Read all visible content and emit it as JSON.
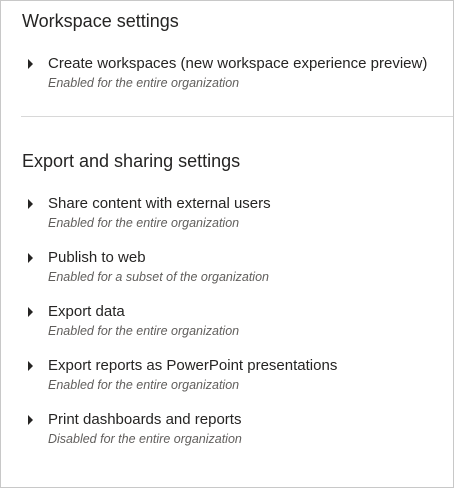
{
  "sections": [
    {
      "title": "Workspace settings",
      "items": [
        {
          "title": "Create workspaces (new workspace experience preview)",
          "status": "Enabled for the entire organization"
        }
      ]
    },
    {
      "title": "Export and sharing settings",
      "items": [
        {
          "title": "Share content with external users",
          "status": "Enabled for the entire organization"
        },
        {
          "title": "Publish to web",
          "status": "Enabled for a subset of the organization"
        },
        {
          "title": "Export data",
          "status": "Enabled for the entire organization"
        },
        {
          "title": "Export reports as PowerPoint presentations",
          "status": "Enabled for the entire organization"
        },
        {
          "title": "Print dashboards and reports",
          "status": "Disabled for the entire organization"
        }
      ]
    }
  ]
}
